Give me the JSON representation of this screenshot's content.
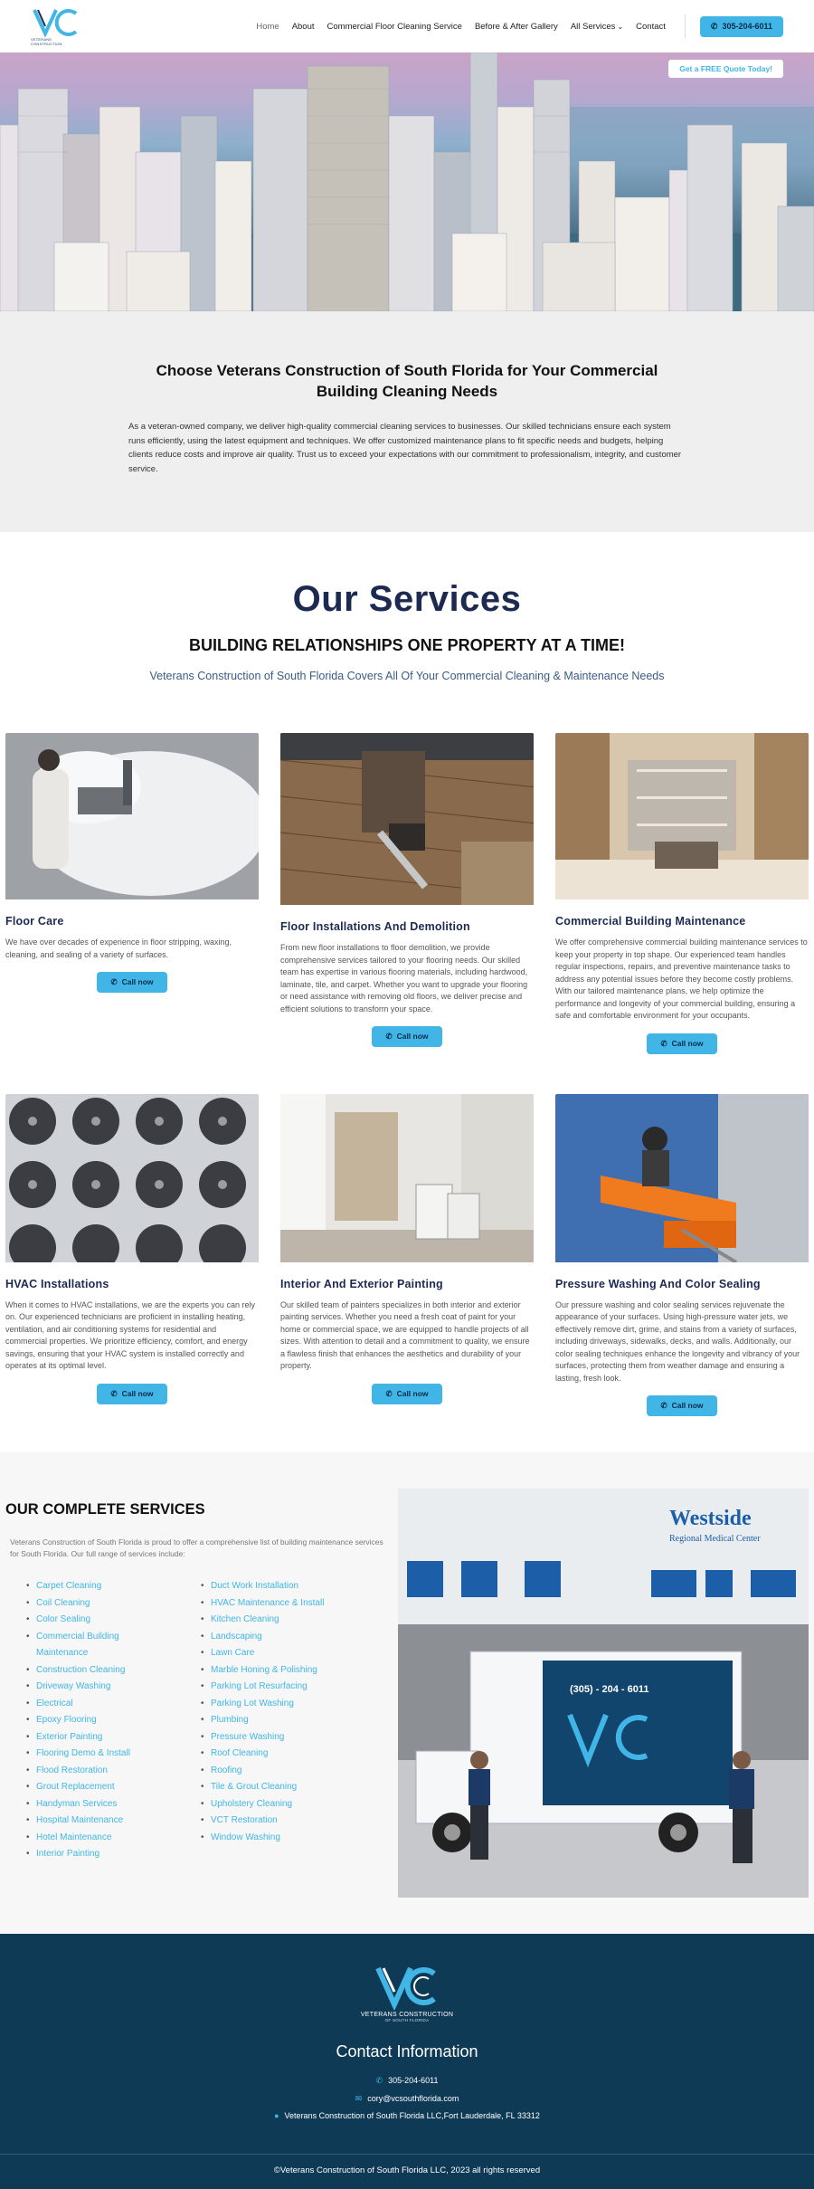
{
  "header": {
    "logo_text": "VETERANS CONSTRUCTION",
    "nav": [
      {
        "label": "Home",
        "active": true
      },
      {
        "label": "About"
      },
      {
        "label": "Commercial Floor Cleaning Service"
      },
      {
        "label": "Before & After Gallery"
      },
      {
        "label": "All Services",
        "dropdown": true
      },
      {
        "label": "Contact"
      }
    ],
    "phone": "305-204-6011"
  },
  "hero": {
    "quote_button": "Get a FREE Quote Today!"
  },
  "intro": {
    "title": "Choose Veterans Construction of South Florida for Your Commercial Building Cleaning Needs",
    "body": "As a veteran-owned company, we deliver high-quality commercial cleaning services to businesses. Our skilled technicians ensure each system runs efficiently, using the latest equipment and techniques. We offer customized maintenance plans to fit specific needs and budgets, helping clients reduce costs and improve air quality. Trust us to exceed your expectations with our commitment to professionalism, integrity, and customer service."
  },
  "services": {
    "title": "Our Services",
    "tagline": "BUILDING RELATIONSHIPS ONE PROPERTY AT A TIME!",
    "subtitle": "Veterans Construction of South Florida Covers All Of Your Commercial Cleaning & Maintenance Needs",
    "call_label": "Call now",
    "cards": [
      {
        "title": "Floor Care",
        "text": "We have over decades of experience in floor stripping, waxing, cleaning, and sealing of a variety of surfaces."
      },
      {
        "title": "Floor Installations And Demolition",
        "text": "From new floor installations to floor demolition, we provide comprehensive services tailored to your flooring needs. Our skilled team has expertise in various flooring materials, including hardwood, laminate, tile, and carpet. Whether you want to upgrade your flooring or need assistance with removing old floors, we deliver precise and efficient solutions to transform your space."
      },
      {
        "title": "Commercial Building Maintenance",
        "text": "We offer comprehensive commercial building maintenance services to keep your property in top shape. Our experienced team handles regular inspections, repairs, and preventive maintenance tasks to address any potential issues before they become costly problems. With our tailored maintenance plans, we help optimize the performance and longevity of your commercial building, ensuring a safe and comfortable environment for your occupants."
      },
      {
        "title": "HVAC Installations",
        "text": "When it comes to HVAC installations, we are the experts you can rely on. Our experienced technicians are proficient in installing heating, ventilation, and air conditioning systems for residential and commercial properties. We prioritize efficiency, comfort, and energy savings, ensuring that your HVAC system is installed correctly and operates at its optimal level."
      },
      {
        "title": "Interior And Exterior Painting",
        "text": "Our skilled team of painters specializes in both interior and exterior painting services. Whether you need a fresh coat of paint for your home or commercial space, we are equipped to handle projects of all sizes. With attention to detail and a commitment to quality, we ensure a flawless finish that enhances the aesthetics and durability of your property."
      },
      {
        "title": "Pressure Washing And Color Sealing",
        "text": "Our pressure washing and color sealing services rejuvenate the appearance of your surfaces. Using high-pressure water jets, we effectively remove dirt, grime, and stains from a variety of surfaces, including driveways, sidewalks, decks, and walls. Additionally, our color sealing techniques enhance the longevity and vibrancy of your surfaces, protecting them from weather damage and ensuring a lasting, fresh look."
      }
    ]
  },
  "complete": {
    "title": "OUR COMPLETE SERVICES",
    "desc": "Veterans Construction of South Florida is proud to offer a comprehensive list of building maintenance services for South Florida. Our full range of services include:",
    "col1": [
      "Carpet Cleaning",
      "Coil Cleaning",
      "Color Sealing",
      "Commercial Building Maintenance",
      "Construction Cleaning",
      "Driveway Washing",
      "Electrical",
      "Epoxy Flooring",
      "Exterior Painting",
      "Flooring Demo & Install",
      "Flood Restoration",
      "Grout Replacement",
      "Handyman Services",
      "Hospital Maintenance",
      "Hotel Maintenance",
      "Interior Painting"
    ],
    "col2": [
      "Duct Work Installation",
      "HVAC Maintenance & Install",
      "Kitchen Cleaning",
      "Landscaping",
      "Lawn Care",
      "Marble Honing & Polishing",
      "Parking Lot Resurfacing",
      "Parking Lot Washing",
      "Plumbing",
      "Pressure Washing",
      "Roof Cleaning",
      "Roofing",
      "Tile & Grout Cleaning",
      "Upholstery Cleaning",
      "VCT Restoration",
      "Window Washing"
    ],
    "photo_sign": "Westside",
    "photo_sign2": "Regional Medical Center",
    "truck_phone": "(305) - 204 - 6011"
  },
  "footer": {
    "logo_line1": "VETERANS CONSTRUCTION",
    "logo_line2": "OF SOUTH FLORIDA",
    "title": "Contact Information",
    "phone": "305-204-6011",
    "email": "cory@vcsouthflorida.com",
    "address": "Veterans Construction of South Florida LLC,Fort Lauderdale, FL 33312",
    "copyright": "©Veterans Construction of South Florida LLC, 2023 all rights reserved"
  },
  "colors": {
    "accent": "#41b6e6",
    "navy": "#1c2a52",
    "footer": "#0e3a56"
  }
}
